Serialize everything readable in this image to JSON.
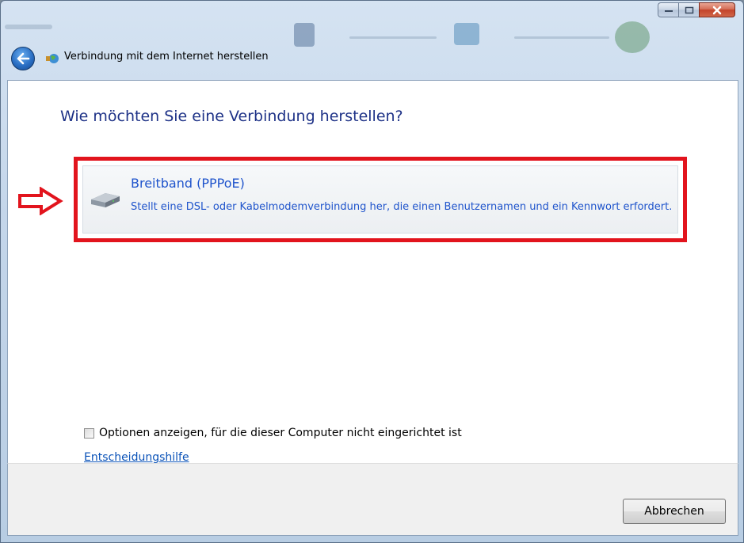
{
  "window": {
    "title": "Verbindung mit dem Internet herstellen",
    "controls": {
      "minimize_icon": "minimize-icon",
      "maximize_icon": "maximize-icon",
      "close_icon": "close-icon"
    }
  },
  "main": {
    "heading": "Wie möchten Sie eine Verbindung herstellen?",
    "options": [
      {
        "title": "Breitband (PPPoE)",
        "description": "Stellt eine DSL- oder Kabelmodemverbindung her, die einen Benutzernamen und ein Kennwort erfordert.",
        "icon": "modem-icon",
        "highlighted": true
      }
    ],
    "checkbox": {
      "label": "Optionen anzeigen, für die dieser Computer nicht eingerichtet ist",
      "checked": false
    },
    "help_link": "Entscheidungshilfe"
  },
  "footer": {
    "cancel_label": "Abbrechen"
  },
  "colors": {
    "heading": "#1e3287",
    "option_text": "#1f54cc",
    "highlight_border": "#e2141d",
    "link": "#0a52b8"
  }
}
